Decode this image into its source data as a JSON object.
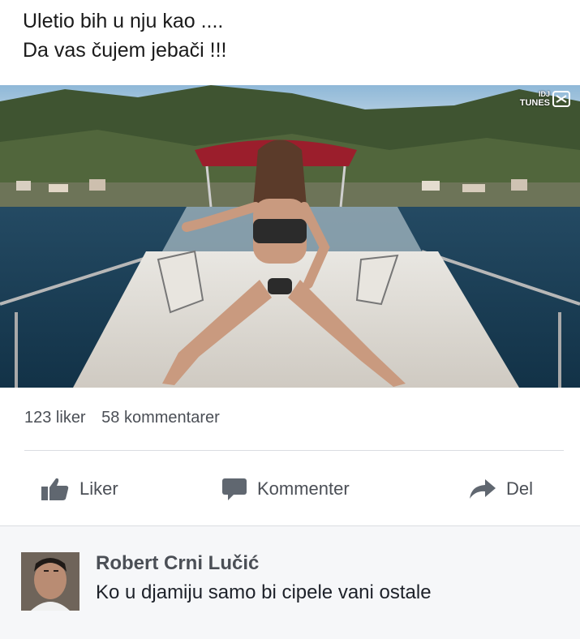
{
  "post": {
    "text_line1": "Uletio bih u nju kao ....",
    "text_line2": "Da vas čujem jebači !!!"
  },
  "media": {
    "watermark_line1": "IDJ",
    "watermark_line2": "TUNES",
    "icon": "logo-icon"
  },
  "stats": {
    "likes": "123 liker",
    "comments": "58 kommentarer"
  },
  "actions": {
    "like_label": "Liker",
    "comment_label": "Kommenter",
    "share_label": "Del",
    "icons": [
      "thumbs-up-icon",
      "comment-bubble-icon",
      "share-arrow-icon"
    ]
  },
  "comment": {
    "author": "Robert Crni Lučić",
    "text": "Ko u djamiju samo bi cipele vani ostale"
  },
  "colors": {
    "text_dark": "#1a1a1a",
    "text_muted": "#4b4f56",
    "divider": "#dadde1",
    "comment_bg": "#f6f7f9"
  }
}
